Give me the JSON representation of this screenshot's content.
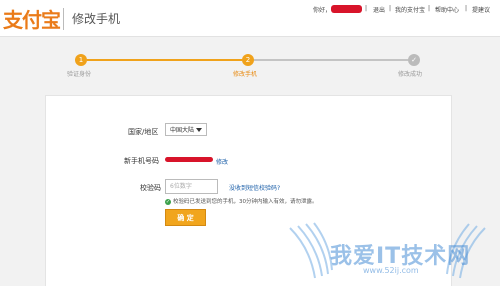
{
  "header": {
    "logo": "支付宝",
    "title": "修改手机",
    "nav": {
      "greeting": "你好，",
      "logout": "退出",
      "my_alipay": "我的支付宝",
      "help_center": "帮助中心",
      "feedback": "提建议"
    }
  },
  "steps": [
    {
      "number": "1",
      "label": "验证身份",
      "status": "done"
    },
    {
      "number": "2",
      "label": "修改手机",
      "status": "current"
    },
    {
      "number": "✓",
      "label": "修改成功",
      "status": "pending"
    }
  ],
  "form": {
    "country_label": "国家/地区",
    "country_value": "中国大陆",
    "new_phone_label": "新手机号码",
    "modify_link": "修改",
    "code_label": "校验码",
    "code_placeholder": "6位数字",
    "resend_link": "没收到短信校验码?",
    "hint": "校验码已发送到您的手机，30分钟内输入有效，请勿泄露。",
    "confirm_button": "确 定"
  },
  "watermark": {
    "text": "我爱IT技术网",
    "url": "www.52ij.com"
  },
  "colors": {
    "brand_orange": "#ea7b19",
    "step_active": "#f0a21b",
    "step_pending": "#bbbbbb",
    "link_blue": "#1a5ea8",
    "redaction_red": "#d8142a"
  }
}
